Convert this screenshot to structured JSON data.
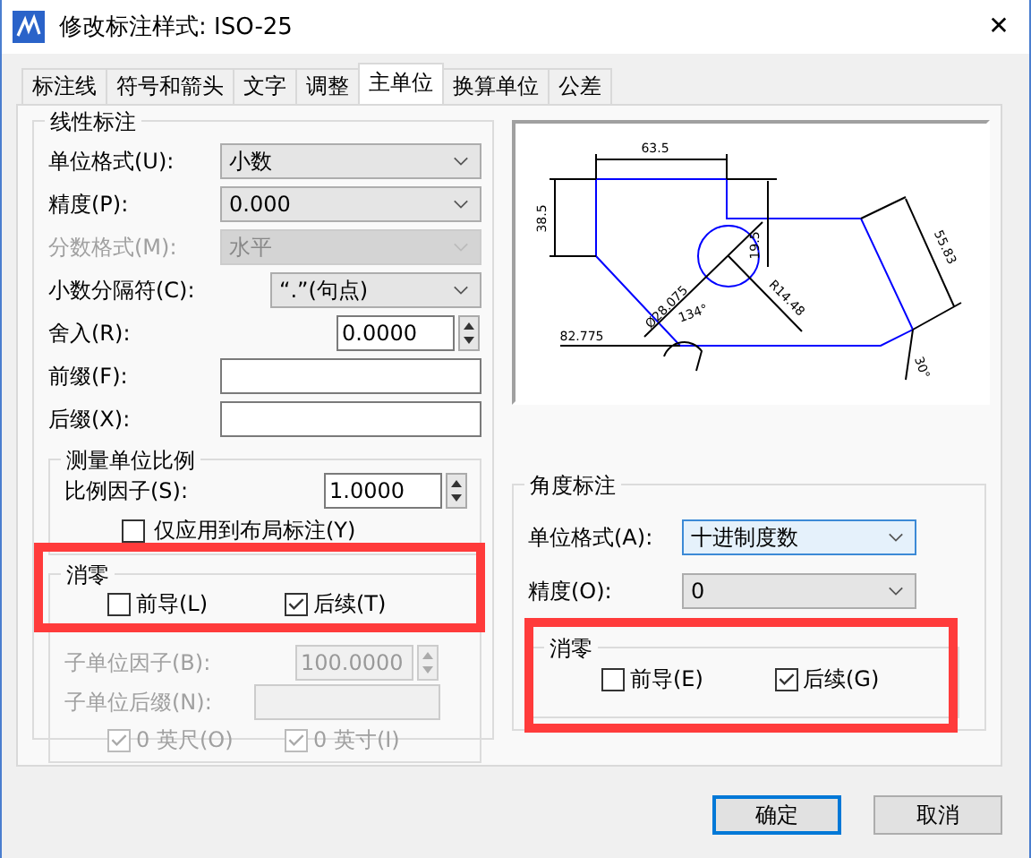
{
  "window": {
    "title": "修改标注样式: ISO-25",
    "close": "✕"
  },
  "tabs": [
    {
      "label": "标注线",
      "selected": false
    },
    {
      "label": "符号和箭头",
      "selected": false
    },
    {
      "label": "文字",
      "selected": false
    },
    {
      "label": "调整",
      "selected": false
    },
    {
      "label": "主单位",
      "selected": true
    },
    {
      "label": "换算单位",
      "selected": false
    },
    {
      "label": "公差",
      "selected": false
    }
  ],
  "linear": {
    "title": "线性标注",
    "fields": [
      {
        "kind": "select",
        "label": "单位格式(U):",
        "value": "小数",
        "disabled": false
      },
      {
        "kind": "select",
        "label": "精度(P):",
        "value": "0.000",
        "disabled": false
      },
      {
        "kind": "select",
        "label": "分数格式(M):",
        "value": "水平",
        "disabled": true
      },
      {
        "kind": "wideselect",
        "label": "小数分隔符(C):",
        "value": "“.”(句点)",
        "disabled": false
      },
      {
        "kind": "spin",
        "label": "舍入(R):",
        "value": "0.0000",
        "disabled": false
      },
      {
        "kind": "text",
        "label": "前缀(F):",
        "disabled": false
      },
      {
        "kind": "text",
        "label": "后缀(X):",
        "disabled": false
      }
    ],
    "scale": {
      "title": "测量单位比例",
      "label": "比例因子(S):",
      "value": "1.0000",
      "layout_only": {
        "label": "仅应用到布局标注(Y)",
        "checked": false
      }
    },
    "zero": {
      "title": "消零",
      "highlighted": true,
      "leading": {
        "label": "前导(L)",
        "checked": false
      },
      "trailing": {
        "label": "后续(T)",
        "checked": true
      },
      "sub_factor": {
        "label": "子单位因子(B):",
        "value": "100.0000",
        "disabled": true
      },
      "sub_suffix": {
        "label": "子单位后缀(N):",
        "disabled": true
      },
      "units": [
        {
          "label": "0 英尺(O)",
          "checked": true,
          "disabled": true
        },
        {
          "label": "0 英寸(I)",
          "checked": true,
          "disabled": true
        }
      ]
    }
  },
  "preview": {
    "labels": [
      {
        "text": "63.5"
      },
      {
        "text": "38.5"
      },
      {
        "text": "82.775"
      },
      {
        "text": "Ø28.075"
      },
      {
        "text": "134°"
      },
      {
        "text": "R14.48"
      },
      {
        "text": "19.5"
      },
      {
        "text": "55.83"
      },
      {
        "text": "30°"
      }
    ]
  },
  "angular": {
    "title": "角度标注",
    "format": {
      "label": "单位格式(A):",
      "value": "十进制度数"
    },
    "precision": {
      "label": "精度(O):",
      "value": "0"
    },
    "zero": {
      "title": "消零",
      "highlighted": true,
      "leading": {
        "label": "前导(E)",
        "checked": false
      },
      "trailing": {
        "label": "后续(G)",
        "checked": true
      }
    }
  },
  "buttons": [
    {
      "label": "确定",
      "kind": "default"
    },
    {
      "label": "取消",
      "kind": "normal"
    }
  ]
}
